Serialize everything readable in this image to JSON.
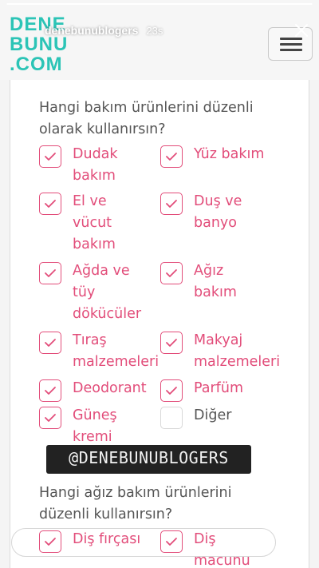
{
  "story": {
    "username": "denebunublogers",
    "time": "23s",
    "progress": 1.0,
    "reply_placeholder": ""
  },
  "logo": {
    "line1": "DENE",
    "line2": "BUNU",
    "line3": ".COM",
    "color": "#2cc4b6"
  },
  "colors": {
    "accent": "#e24d7a",
    "teal": "#2cc4b6",
    "text": "#555555"
  },
  "q1": {
    "text": "Hangi bakım ürünlerini düzenli olarak kullanırsın?",
    "options": [
      {
        "label": "Dudak bakım",
        "checked": true
      },
      {
        "label": "Yüz bakım",
        "checked": true
      },
      {
        "label": "El ve vücut bakım",
        "checked": true
      },
      {
        "label": "Duş ve banyo",
        "checked": true
      },
      {
        "label": "Ağda ve tüy dökücüler",
        "checked": true
      },
      {
        "label": "Ağız bakım",
        "checked": true
      },
      {
        "label": "Tıraş malzemeleri",
        "checked": true
      },
      {
        "label": "Makyaj malzemeleri",
        "checked": true
      },
      {
        "label": "Deodorant",
        "checked": true
      },
      {
        "label": "Parfüm",
        "checked": true
      },
      {
        "label": "Güneş kremi",
        "checked": true
      },
      {
        "label": "Diğer",
        "checked": false
      }
    ]
  },
  "tag": {
    "text": "@DENEBUNUBLOGERS"
  },
  "q2": {
    "text": "Hangi ağız bakım ürünlerini düzenli kullanırsın?",
    "options": [
      {
        "label": "Diş fırçası",
        "checked": true
      },
      {
        "label": "Diş macunu",
        "checked": true
      }
    ]
  },
  "icons": {
    "close": "close-icon",
    "menu": "hamburger-menu-icon",
    "send": "send-icon",
    "check": "check-icon"
  }
}
